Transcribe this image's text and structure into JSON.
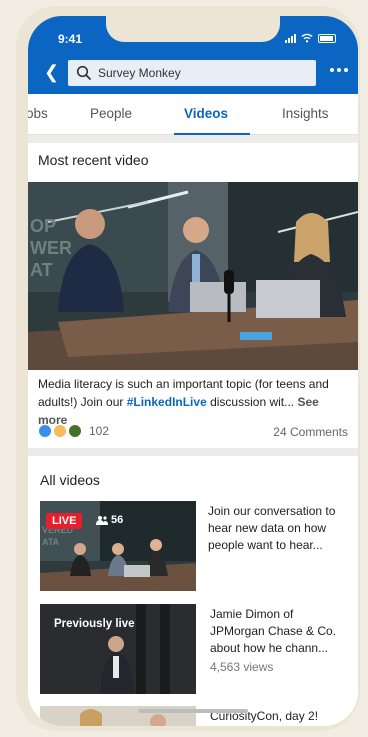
{
  "status_bar": {
    "time": "9:41"
  },
  "header": {
    "search_value": "Survey Monkey"
  },
  "tabs": [
    {
      "label": "obs"
    },
    {
      "label": "People"
    },
    {
      "label": "Videos"
    },
    {
      "label": "Insights"
    }
  ],
  "active_tab": "Videos",
  "most_recent": {
    "title": "Most recent video",
    "caption_prefix": "Media literacy is such an important topic (for teens and adults!) Join our ",
    "caption_tag": "#LinkedInLive",
    "caption_suffix": " discussion wit... ",
    "see_more": "See more",
    "reaction_count": "102",
    "comments": "24 Comments"
  },
  "all_videos": {
    "title": "All videos",
    "items": [
      {
        "badge": "LIVE",
        "viewers": "56",
        "text": "Join our conversation to hear new data on how people want to hear...",
        "views": ""
      },
      {
        "badge": "Previously live",
        "text": "Jamie Dimon of JPMorgan Chase & Co. about how he chann...",
        "views": "4,563 views"
      },
      {
        "text": "CuriosityCon, day 2!"
      }
    ]
  },
  "colors": {
    "brand": "#0a66c2",
    "live": "#e4202e"
  }
}
